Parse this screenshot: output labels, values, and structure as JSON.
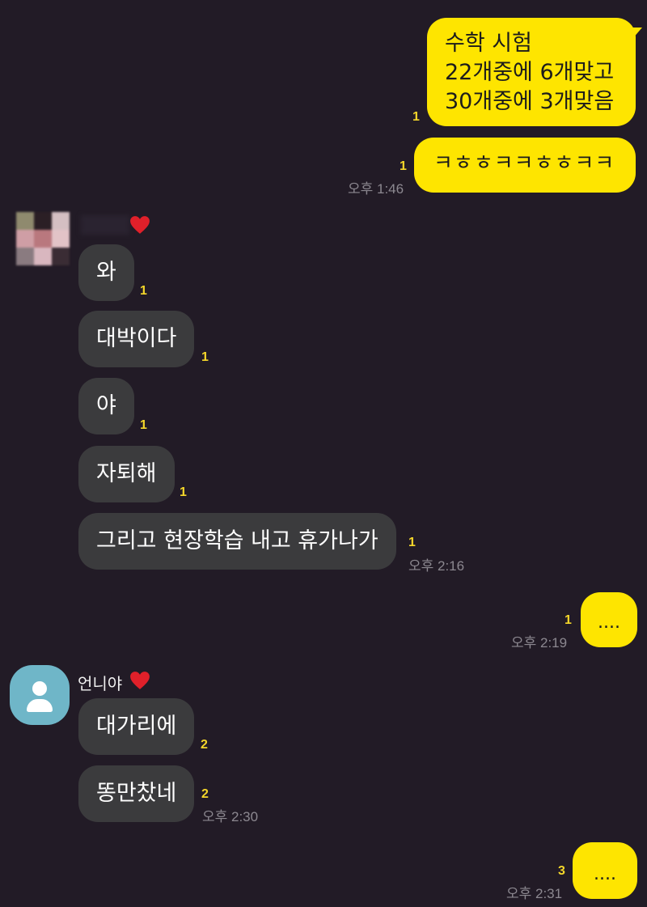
{
  "messages": {
    "me1": {
      "lines": [
        "수학 시험",
        "22개중에 6개맞고",
        "30개중에 3개맞음"
      ],
      "unread": "1"
    },
    "me2": {
      "text": "ㅋㅎㅎㅋㅋㅎㅎㅋㅋ",
      "unread": "1",
      "time": "오후 1:46"
    },
    "group1": {
      "items": [
        {
          "text": "와",
          "unread": "1"
        },
        {
          "text": "대박이다",
          "unread": "1"
        },
        {
          "text": "야",
          "unread": "1"
        },
        {
          "text": "자퇴해",
          "unread": "1"
        },
        {
          "text": "그리고 현장학습 내고 휴가나가",
          "unread": "1"
        }
      ],
      "time": "오후 2:16"
    },
    "me3": {
      "text": "....",
      "unread": "1",
      "time": "오후 2:19"
    },
    "group2": {
      "sender": "언니야",
      "items": [
        {
          "text": "대가리에",
          "unread": "2"
        },
        {
          "text": "똥만찼네",
          "unread": "2"
        }
      ],
      "time": "오후 2:30"
    },
    "me4": {
      "text": "....",
      "unread": "3",
      "time": "오후 2:31"
    }
  },
  "icons": {
    "heart": "heart-icon",
    "avatar": "default-profile-icon"
  },
  "colors": {
    "background": "#221b26",
    "my_bubble": "#fee500",
    "other_bubble": "#3b3b3d",
    "unread": "#f5d72a"
  }
}
